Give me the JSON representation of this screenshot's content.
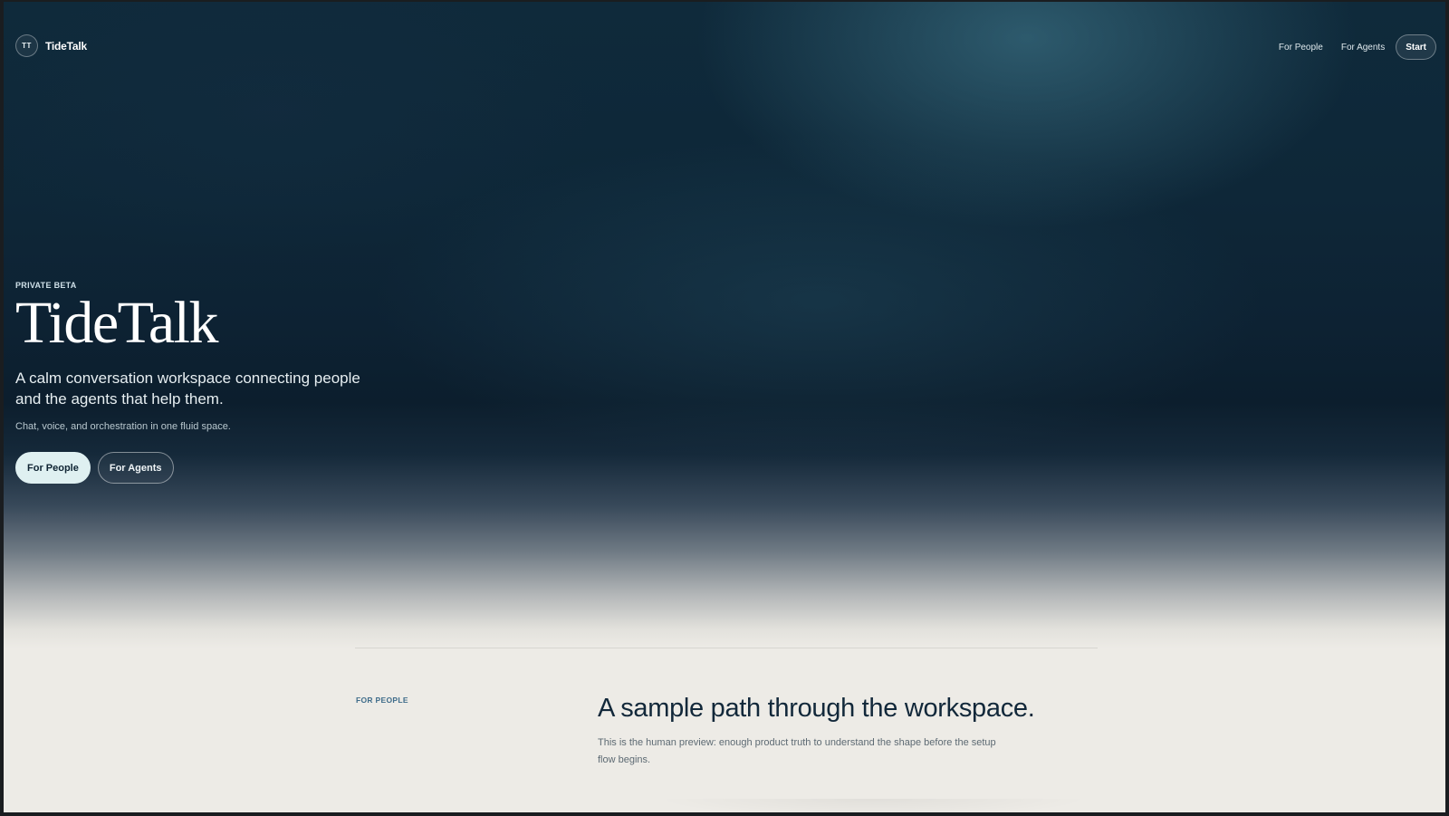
{
  "header": {
    "logo_initials": "TT",
    "brand_name": "TideTalk",
    "nav": {
      "for_people": "For People",
      "for_agents": "For Agents",
      "start": "Start"
    }
  },
  "hero": {
    "eyebrow": "PRIVATE BETA",
    "title": "TideTalk",
    "tagline": "A calm conversation workspace connecting people and the agents that help them.",
    "subtitle": "Chat, voice, and orchestration in one fluid space.",
    "cta_primary": "For People",
    "cta_secondary": "For Agents"
  },
  "section": {
    "eyebrow": "FOR PEOPLE",
    "title": "A sample path through the workspace.",
    "description": "This is the human preview: enough product truth to understand the shape before the setup flow begins."
  },
  "colors": {
    "hero_dark": "#0d2233",
    "page_background": "#edebe6",
    "accent_text": "#3f6c8a",
    "cta_primary_bg": "#dff0f1"
  },
  "icons": {
    "logo": "tidetalk-logo-mark"
  }
}
